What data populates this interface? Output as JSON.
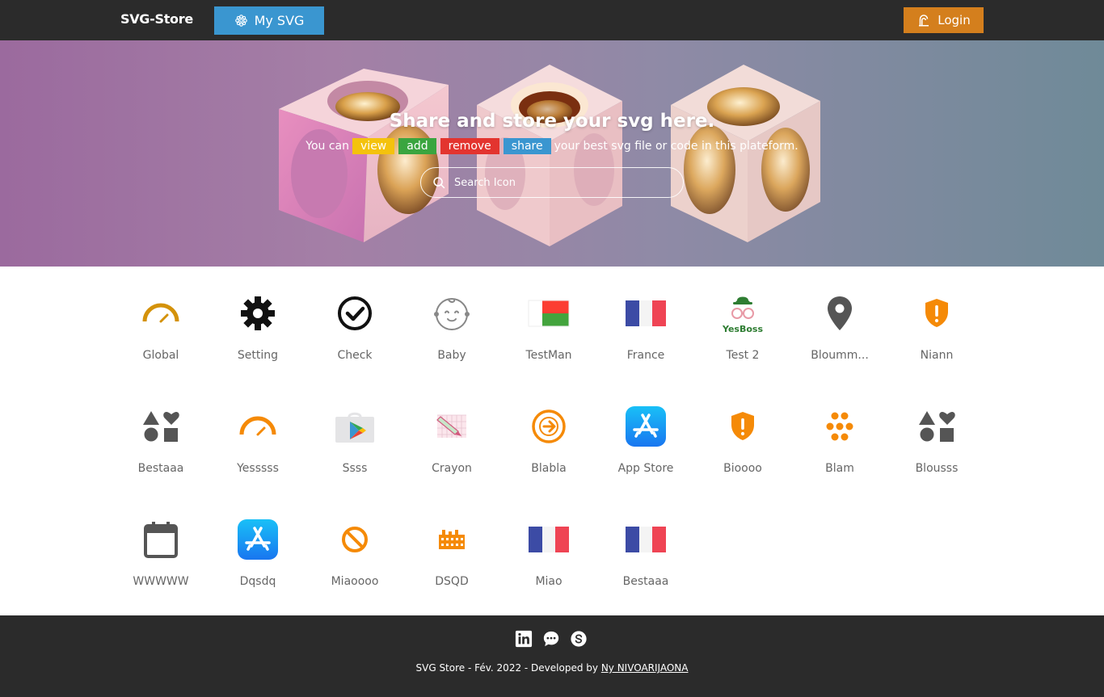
{
  "nav": {
    "brand": "SVG-Store",
    "mysvg_label": "My SVG",
    "login_label": "Login"
  },
  "hero": {
    "title": "Share and store your svg here.",
    "sub_lead": "You can",
    "chips": [
      "view",
      "add",
      "remove",
      "share"
    ],
    "sub_tail": "your best svg file or code in this plateform.",
    "search_placeholder": "Search Icon"
  },
  "icons": [
    {
      "label": "Global",
      "icon": "gauge-icon",
      "color": "#d4920a"
    },
    {
      "label": "Setting",
      "icon": "gear-icon",
      "color": "#111111"
    },
    {
      "label": "Check",
      "icon": "check-circle-icon",
      "color": "#111111"
    },
    {
      "label": "Baby",
      "icon": "baby-face-icon",
      "color": "#888888"
    },
    {
      "label": "TestMan",
      "icon": "madagascar-flag-icon",
      "color": "#fc3d32"
    },
    {
      "label": "France",
      "icon": "france-flag-icon",
      "color": "#3c4ba5"
    },
    {
      "label": "Test 2",
      "icon": "yesboss-logo-icon",
      "color": "#2e7d32",
      "text": "YesBoss"
    },
    {
      "label": "Bloumm...",
      "icon": "map-pin-icon",
      "color": "#555555"
    },
    {
      "label": "Niann",
      "icon": "shield-alert-icon",
      "color": "#f58a07"
    },
    {
      "label": "Bestaaa",
      "icon": "shapes-icon",
      "color": "#555555"
    },
    {
      "label": "Yesssss",
      "icon": "gauge-icon",
      "color": "#f58a07"
    },
    {
      "label": "Ssss",
      "icon": "play-store-icon",
      "color": "#3a96d0"
    },
    {
      "label": "Crayon",
      "icon": "crayon-icon",
      "color": "#d15a7e"
    },
    {
      "label": "Blabla",
      "icon": "arrow-circle-icon",
      "color": "#f58a07"
    },
    {
      "label": "App Store",
      "icon": "app-store-icon",
      "color": "#1a9ff0"
    },
    {
      "label": "Bioooo",
      "icon": "shield-alert-icon",
      "color": "#f58a07"
    },
    {
      "label": "Blam",
      "icon": "honeycomb-icon",
      "color": "#f58a07"
    },
    {
      "label": "Blousss",
      "icon": "shapes-icon",
      "color": "#555555"
    },
    {
      "label": "WWWWW",
      "icon": "calendar-icon",
      "color": "#555555"
    },
    {
      "label": "Dqsdq",
      "icon": "app-store-icon",
      "color": "#1a9ff0"
    },
    {
      "label": "Miaoooo",
      "icon": "ban-icon",
      "color": "#f58a07"
    },
    {
      "label": "DSQD",
      "icon": "building-icon",
      "color": "#f58a07"
    },
    {
      "label": "Miao",
      "icon": "france-flag-icon",
      "color": "#3c4ba5"
    },
    {
      "label": "Bestaaa",
      "icon": "france-flag-icon",
      "color": "#3c4ba5"
    }
  ],
  "footer": {
    "credit_text": "SVG Store - Fév. 2022 - Developed by",
    "author": "Ny NIVOARIJAONA",
    "social": [
      "linkedin-icon",
      "chat-bubble-icon",
      "skype-icon"
    ]
  }
}
